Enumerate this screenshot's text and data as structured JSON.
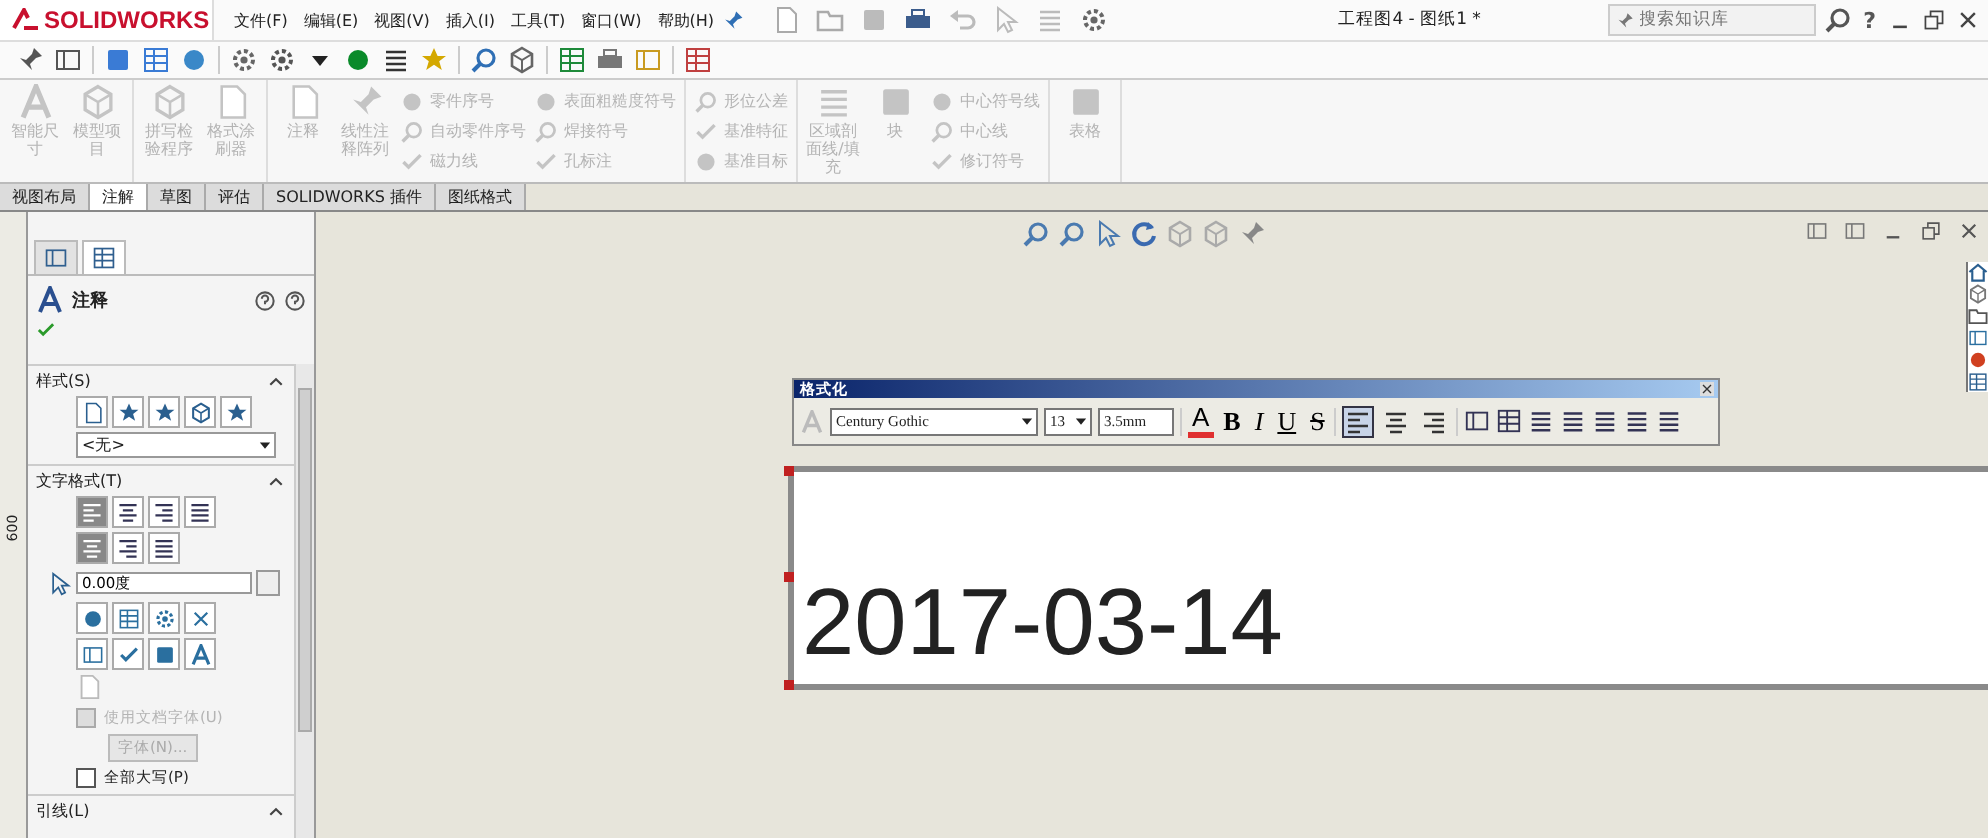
{
  "title_bar": {
    "logo": "SOLIDWORKS",
    "menus": [
      "文件(F)",
      "编辑(E)",
      "视图(V)",
      "插入(I)",
      "工具(T)",
      "窗口(W)",
      "帮助(H)"
    ],
    "document_title": "工程图4 - 图纸1 *",
    "search": {
      "placeholder": "搜索知识库"
    },
    "help": "?"
  },
  "ribbon": {
    "groups": [
      {
        "items": [
          {
            "kind": "large",
            "label": "智能尺寸",
            "disabled": true
          },
          {
            "kind": "large",
            "label": "模型项目",
            "disabled": true
          }
        ]
      },
      {
        "items": [
          {
            "kind": "large",
            "label": "拼写检验程序",
            "disabled": true
          },
          {
            "kind": "large",
            "label": "格式涂刷器",
            "disabled": true
          }
        ]
      },
      {
        "items": [
          {
            "kind": "large",
            "label": "注释",
            "disabled": true
          },
          {
            "kind": "large",
            "label": "线性注释阵列",
            "disabled": true
          },
          {
            "kind": "small",
            "label": "零件序号",
            "disabled": true
          },
          {
            "kind": "small",
            "label": "自动零件序号",
            "disabled": true
          },
          {
            "kind": "small",
            "label": "磁力线",
            "disabled": true
          },
          {
            "kind": "small",
            "label": "表面粗糙度符号",
            "disabled": true
          },
          {
            "kind": "small",
            "label": "焊接符号",
            "disabled": true
          },
          {
            "kind": "small",
            "label": "孔标注",
            "disabled": true
          }
        ]
      },
      {
        "items": [
          {
            "kind": "small",
            "label": "形位公差",
            "disabled": true
          },
          {
            "kind": "small",
            "label": "基准特征",
            "disabled": true
          },
          {
            "kind": "small",
            "label": "基准目标",
            "disabled": true
          }
        ]
      },
      {
        "items": [
          {
            "kind": "large",
            "label": "区域剖面线/填充",
            "disabled": true
          },
          {
            "kind": "large",
            "label": "块",
            "disabled": true
          },
          {
            "kind": "small",
            "label": "中心符号线",
            "disabled": true
          },
          {
            "kind": "small",
            "label": "中心线",
            "disabled": true
          },
          {
            "kind": "small",
            "label": "修订符号",
            "disabled": true
          }
        ]
      },
      {
        "items": [
          {
            "kind": "large",
            "label": "表格",
            "disabled": true
          }
        ]
      }
    ]
  },
  "tabs": [
    {
      "label": "视图布局",
      "selected": false
    },
    {
      "label": "注解",
      "selected": true
    },
    {
      "label": "草图",
      "selected": false
    },
    {
      "label": "评估",
      "selected": false
    },
    {
      "label": "SOLIDWORKS 插件",
      "selected": false
    },
    {
      "label": "图纸格式",
      "selected": false
    }
  ],
  "left_ruler": {
    "label": "600"
  },
  "property_manager": {
    "tabs": [
      {
        "selected": false
      },
      {
        "selected": true
      }
    ],
    "title": "注释",
    "style_section": {
      "title": "样式(S)",
      "expanded": true,
      "dropdown": "<无>"
    },
    "text_format_section": {
      "title": "文字格式(T)",
      "expanded": true,
      "align_buttons": [
        {
          "selected": true
        },
        {
          "selected": false
        },
        {
          "selected": false
        },
        {
          "selected": false
        }
      ],
      "valign_buttons": [
        {
          "selected": true
        },
        {
          "selected": false
        },
        {
          "selected": false
        }
      ],
      "angle": {
        "value": "0.00度"
      },
      "use_document_font": {
        "label": "使用文档字体(U)",
        "checked": false,
        "disabled": true
      },
      "font_button": {
        "label": "字体(N)...",
        "disabled": true
      },
      "all_caps": {
        "label": "全部大写(P)",
        "checked": false,
        "disabled": false
      }
    },
    "leader_section": {
      "title": "引线(L)",
      "expanded": true
    }
  },
  "format_toolbar": {
    "title": "格式化",
    "font": "Century Gothic",
    "size": "13",
    "height": "3.5mm",
    "style_buttons": [
      {
        "kind": "color",
        "label": "A"
      },
      {
        "kind": "bold",
        "label": "B"
      },
      {
        "kind": "italic",
        "label": "I"
      },
      {
        "kind": "underline",
        "label": "U"
      },
      {
        "kind": "strike",
        "label": "S"
      }
    ],
    "align_buttons": [
      {
        "selected": true
      },
      {
        "selected": false
      },
      {
        "selected": false
      }
    ]
  },
  "note": {
    "text": "2017-03-14"
  }
}
